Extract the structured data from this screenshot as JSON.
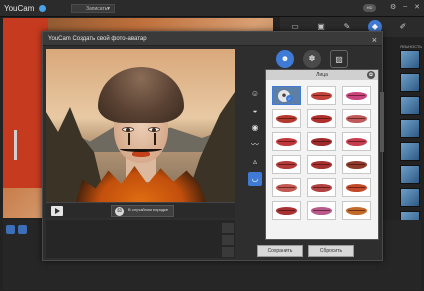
{
  "main": {
    "app_name": "YouCam",
    "record_label": "Записать",
    "badge": "HD",
    "strip_label": "ЯЛЬНОСТЬ"
  },
  "dialog": {
    "title": "YouCam Создать свой фото-аватар",
    "close_icon": "×",
    "random_button": "В случайном порядке",
    "panel_title": "Лица",
    "save_label": "Сохранить",
    "reset_label": "Сбросить"
  },
  "lip_colors": [
    "selected",
    "#c2413a",
    "#c9447f",
    "#b43a2e",
    "#b0302e",
    "#c05a5a",
    "#c0383a",
    "#9e2c2c",
    "#c63d50",
    "#b33a36",
    "#a43030",
    "#8e3a2a",
    "#c05a52",
    "#b24141",
    "#c24a2a",
    "#a83232",
    "#b95a8c",
    "#c26a2a"
  ],
  "accent": "#3f7bd6"
}
